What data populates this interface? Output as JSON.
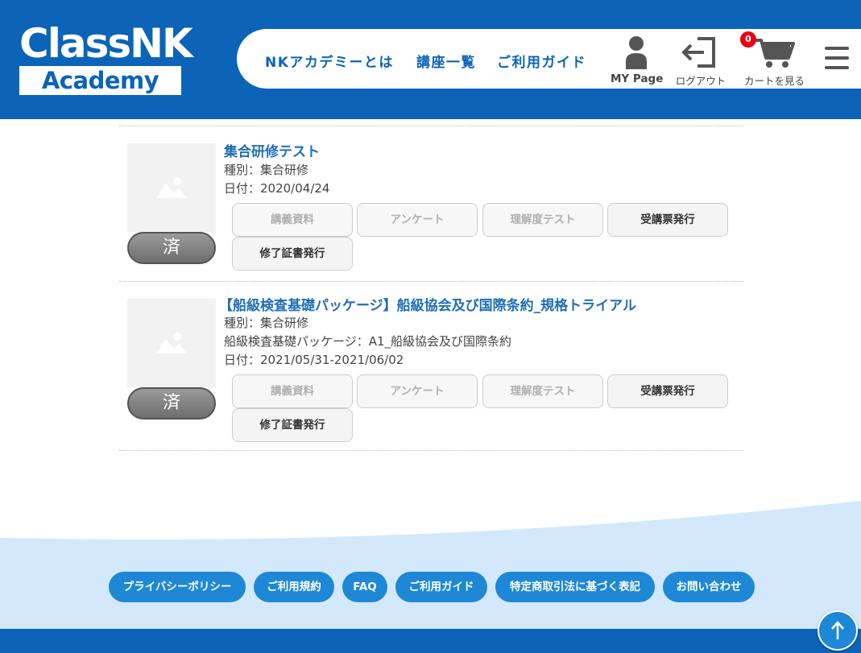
{
  "header": {
    "logo_top": "ClassNK",
    "logo_bottom": "Academy",
    "nav": [
      "NKアカデミーとは",
      "講座一覧",
      "ご利用ガイド"
    ],
    "mypage_label": "MY Page",
    "logout_label": "ログアウト",
    "cart_label": "カートを見る",
    "cart_count": "0",
    "brand_color": "#0b64b8"
  },
  "courses": [
    {
      "title": "集合研修テスト",
      "type": "種別：集合研修",
      "package": "",
      "date": "日付：2020/04/24",
      "status": "済",
      "buttons": [
        {
          "label": "講義資料",
          "enabled": false
        },
        {
          "label": "アンケート",
          "enabled": false
        },
        {
          "label": "理解度テスト",
          "enabled": false
        },
        {
          "label": "受講票発行",
          "enabled": true
        },
        {
          "label": "修了証書発行",
          "enabled": true
        }
      ]
    },
    {
      "title": "【船級検査基礎パッケージ】船級協会及び国際条約_規格トライアル",
      "type": "種別：集合研修",
      "package": "船級検査基礎パッケージ：A1_船級協会及び国際条約",
      "date": "日付：2021/05/31-2021/06/02",
      "status": "済",
      "buttons": [
        {
          "label": "講義資料",
          "enabled": false
        },
        {
          "label": "アンケート",
          "enabled": false
        },
        {
          "label": "理解度テスト",
          "enabled": false
        },
        {
          "label": "受講票発行",
          "enabled": true
        },
        {
          "label": "修了証書発行",
          "enabled": true
        }
      ]
    }
  ],
  "footer": {
    "links": [
      "プライバシーポリシー",
      "ご利用規約",
      "FAQ",
      "ご利用ガイド",
      "特定商取引法に基づく表記",
      "お問い合わせ"
    ],
    "to_top_icon": "arrow-up-icon"
  }
}
